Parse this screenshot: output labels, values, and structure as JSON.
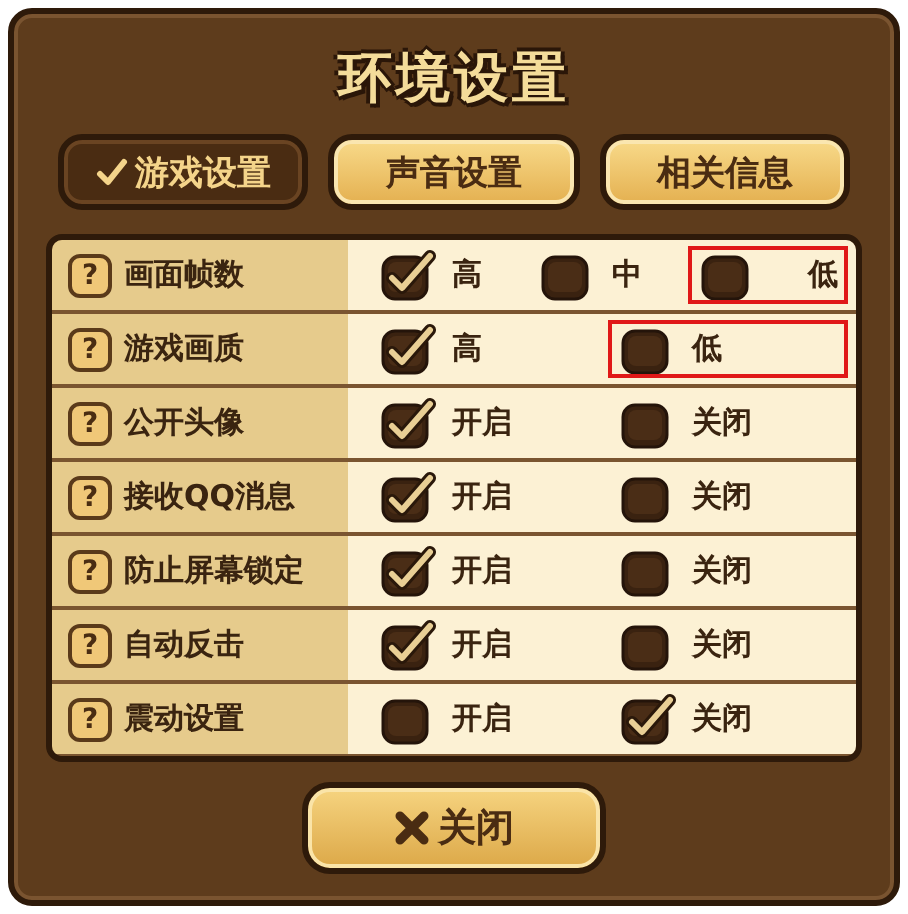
{
  "window": {
    "title": "环境设置"
  },
  "tabs": [
    {
      "label": "游戏设置",
      "selected": true
    },
    {
      "label": "声音设置",
      "selected": false
    },
    {
      "label": "相关信息",
      "selected": false
    }
  ],
  "settings": [
    {
      "help": "?",
      "label": "画面帧数",
      "options": [
        {
          "label": "高",
          "checked": true,
          "highlighted": false
        },
        {
          "label": "中",
          "checked": false,
          "highlighted": false
        },
        {
          "label": "低",
          "checked": false,
          "highlighted": true
        }
      ]
    },
    {
      "help": "?",
      "label": "游戏画质",
      "options": [
        {
          "label": "高",
          "checked": true,
          "highlighted": false
        },
        {
          "label": "低",
          "checked": false,
          "highlighted": true
        }
      ]
    },
    {
      "help": "?",
      "label": "公开头像",
      "options": [
        {
          "label": "开启",
          "checked": true,
          "highlighted": false
        },
        {
          "label": "关闭",
          "checked": false,
          "highlighted": false
        }
      ]
    },
    {
      "help": "?",
      "label": "接收QQ消息",
      "options": [
        {
          "label": "开启",
          "checked": true,
          "highlighted": false
        },
        {
          "label": "关闭",
          "checked": false,
          "highlighted": false
        }
      ]
    },
    {
      "help": "?",
      "label": "防止屏幕锁定",
      "options": [
        {
          "label": "开启",
          "checked": true,
          "highlighted": false
        },
        {
          "label": "关闭",
          "checked": false,
          "highlighted": false
        }
      ]
    },
    {
      "help": "?",
      "label": "自动反击",
      "options": [
        {
          "label": "开启",
          "checked": true,
          "highlighted": false
        },
        {
          "label": "关闭",
          "checked": false,
          "highlighted": false
        }
      ]
    },
    {
      "help": "?",
      "label": "震动设置",
      "options": [
        {
          "label": "开启",
          "checked": false,
          "highlighted": false
        },
        {
          "label": "关闭",
          "checked": true,
          "highlighted": false
        }
      ]
    }
  ],
  "close_button": {
    "label": "关闭"
  }
}
